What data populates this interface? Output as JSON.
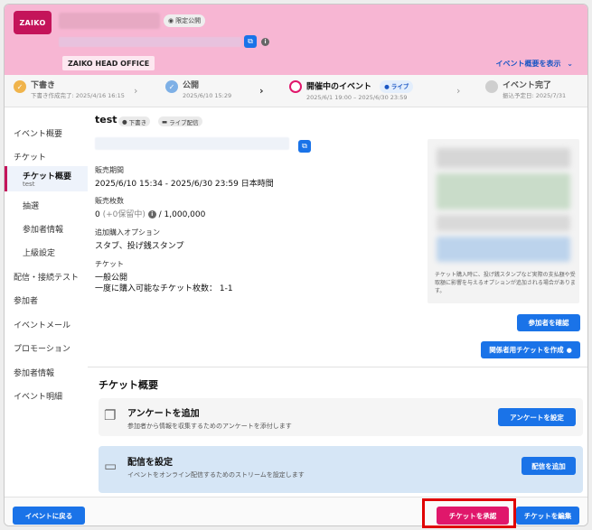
{
  "header": {
    "logo_text": "ZAIKO",
    "private_badge": "限定公開",
    "organization": "ZAIKO HEAD OFFICE",
    "show_summary": "イベント概要を表示",
    "colors": {
      "background": "#f7b6d3",
      "logo": "#c4145a"
    }
  },
  "steps": [
    {
      "title": "下書き",
      "sub": "下書き作成完了: 2025/4/16 16:15",
      "state": "done",
      "icon": "check-icon"
    },
    {
      "title": "公開",
      "sub": "2025/6/10 15:29",
      "state": "done",
      "icon": "check-icon"
    },
    {
      "title": "開催中のイベント",
      "sub": "2025/6/1 19:00 – 2025/6/30 23:59",
      "state": "current",
      "badge": "ライブ"
    },
    {
      "title": "イベント完了",
      "sub": "振込予定日: 2025/7/31",
      "state": "pending"
    }
  ],
  "sidebar": {
    "items": [
      {
        "label": "イベント概要"
      },
      {
        "label": "チケット"
      },
      {
        "label": "チケット概要",
        "sub": "test",
        "active": true
      },
      {
        "label": "抽選"
      },
      {
        "label": "参加者情報"
      },
      {
        "label": "上級設定"
      },
      {
        "label": "配信・接続テスト"
      },
      {
        "label": "参加者"
      },
      {
        "label": "イベントメール"
      },
      {
        "label": "プロモーション"
      },
      {
        "label": "参加者情報"
      },
      {
        "label": "イベント明細"
      }
    ]
  },
  "ticket": {
    "name": "test",
    "tags": [
      "下書き",
      "ライブ配信"
    ],
    "sales_period_label": "販売期間",
    "sales_period": "2025/6/10 15:34 - 2025/6/30 23:59 日本時間",
    "sales_count_label": "販売枚数",
    "sales_count_sold": "0",
    "sales_count_hold": "(+0保留中)",
    "sales_count_total": "/ 1,000,000",
    "addon_label": "追加購入オプション",
    "addon_value": "スタブ、投げ銭スタンプ",
    "ticket_label": "チケット",
    "ticket_public": "一般公開",
    "ticket_limit": "一度に購入可能なチケット枚数： 1-1",
    "preview_note": "チケット購入時に、投げ銭スタンプなど実際の支払額や受取額に影響を与えるオプションが追加される場合があります。"
  },
  "buttons": {
    "check_participants": "参加者を確認",
    "create_staff_ticket": "関係者用チケットを作成",
    "back_to_event": "イベントに戻る",
    "approve_ticket": "チケットを承認",
    "edit_ticket": "チケットを編集"
  },
  "section": {
    "title": "チケット概要",
    "cards": [
      {
        "title": "アンケートを追加",
        "desc": "参加者から情報を収集するためのアンケートを添付します",
        "button": "アンケートを設定",
        "icon": "survey-icon"
      },
      {
        "title": "配信を設定",
        "desc": "イベントをオンライン配信するためのストリームを設定します",
        "button": "配信を追加",
        "icon": "cast-icon"
      }
    ]
  }
}
